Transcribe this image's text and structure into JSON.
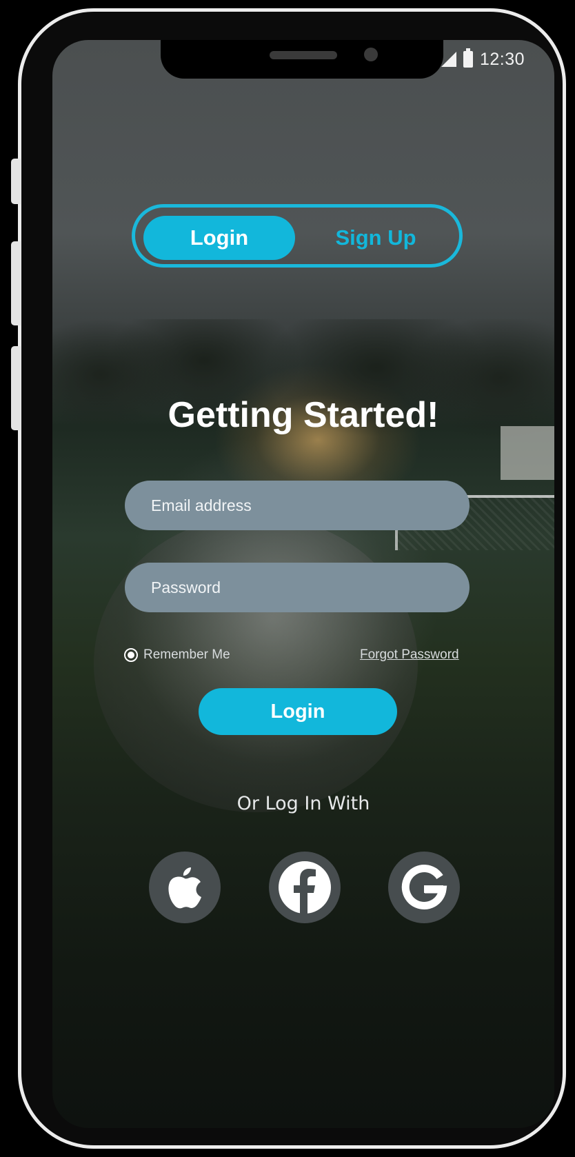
{
  "status_bar": {
    "time": "12:30"
  },
  "auth_toggle": {
    "login_label": "Login",
    "signup_label": "Sign Up",
    "selected": "Login"
  },
  "form": {
    "title": "Getting Started!",
    "email_placeholder": "Email address",
    "password_placeholder": "Password",
    "remember_label": "Remember Me",
    "remember_checked": true,
    "forgot_label": "Forgot Password",
    "login_button_label": "Login"
  },
  "social": {
    "prompt": "Or Log In With",
    "providers": [
      {
        "icon": "apple-icon"
      },
      {
        "icon": "facebook-icon"
      },
      {
        "icon": "google-icon"
      }
    ]
  },
  "colors": {
    "accent": "#12b7db",
    "input_bg": "#7d909c",
    "social_bg": "#474d4f"
  }
}
